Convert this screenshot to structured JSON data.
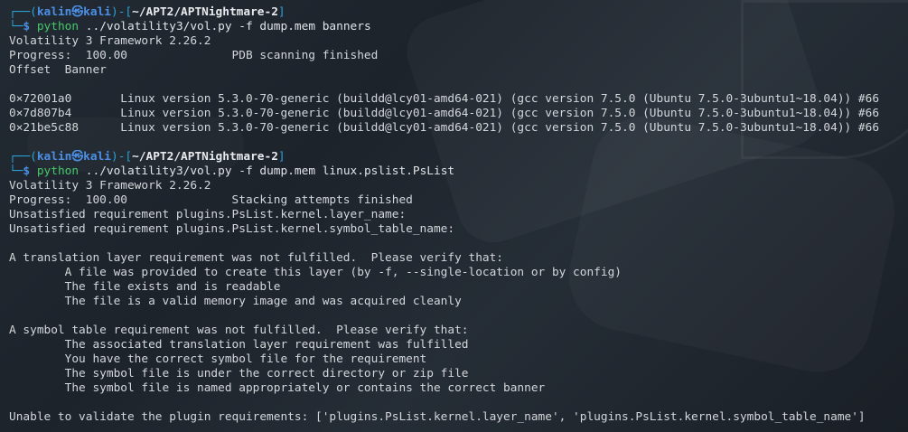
{
  "session1": {
    "prompt": {
      "open": "┌──(",
      "user": "kalin",
      "at": "㉿",
      "host": "kali",
      "mid": ")-[",
      "dir": "~/APT2/APTNightmare-2",
      "close": "]"
    },
    "cmd": {
      "lead": "└─",
      "dollar": "$ ",
      "bin": "python",
      "args": " ../volatility3/vol.py -f dump.mem banners"
    },
    "output": [
      "Volatility 3 Framework 2.26.2",
      "Progress:  100.00\t\tPDB scanning finished",
      "Offset\tBanner",
      "",
      "0×72001a0\tLinux version 5.3.0-70-generic (buildd@lcy01-amd64-021) (gcc version 7.5.0 (Ubuntu 7.5.0-3ubuntu1~18.04)) #66",
      "0×7d807b4\tLinux version 5.3.0-70-generic (buildd@lcy01-amd64-021) (gcc version 7.5.0 (Ubuntu 7.5.0-3ubuntu1~18.04)) #66",
      "0×21be5c88\tLinux version 5.3.0-70-generic (buildd@lcy01-amd64-021) (gcc version 7.5.0 (Ubuntu 7.5.0-3ubuntu1~18.04)) #66"
    ]
  },
  "session2": {
    "prompt": {
      "open": "┌──(",
      "user": "kalin",
      "at": "㉿",
      "host": "kali",
      "mid": ")-[",
      "dir": "~/APT2/APTNightmare-2",
      "close": "]"
    },
    "cmd": {
      "lead": "└─",
      "dollar": "$ ",
      "bin": "python",
      "args": " ../volatility3/vol.py -f dump.mem linux.pslist.PsList"
    },
    "output": [
      "Volatility 3 Framework 2.26.2",
      "Progress:  100.00\t\tStacking attempts finished",
      "Unsatisfied requirement plugins.PsList.kernel.layer_name:",
      "Unsatisfied requirement plugins.PsList.kernel.symbol_table_name:",
      "",
      "A translation layer requirement was not fulfilled.  Please verify that:",
      "\tA file was provided to create this layer (by -f, --single-location or by config)",
      "\tThe file exists and is readable",
      "\tThe file is a valid memory image and was acquired cleanly",
      "",
      "A symbol table requirement was not fulfilled.  Please verify that:",
      "\tThe associated translation layer requirement was fulfilled",
      "\tYou have the correct symbol file for the requirement",
      "\tThe symbol file is under the correct directory or zip file",
      "\tThe symbol file is named appropriately or contains the correct banner",
      "",
      "Unable to validate the plugin requirements: ['plugins.PsList.kernel.layer_name', 'plugins.PsList.kernel.symbol_table_name']"
    ]
  }
}
